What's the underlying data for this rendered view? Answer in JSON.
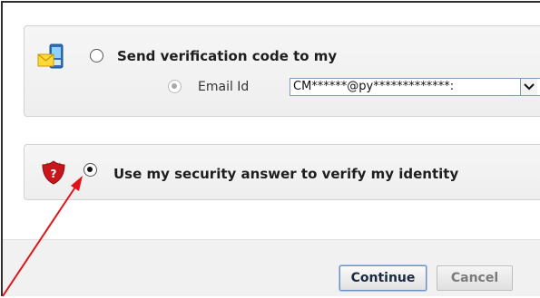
{
  "option_send_code": {
    "label": "Send verification code to my",
    "selected": false,
    "channel": {
      "label": "Email Id",
      "selected": true,
      "value": "CM******@py*************:"
    }
  },
  "option_security": {
    "label": "Use my security answer to verify my identity",
    "selected": true
  },
  "buttons": {
    "continue": "Continue",
    "cancel": "Cancel"
  },
  "annotation": {
    "color": "#e0131b",
    "kind": "arrow"
  },
  "icons": [
    "message-phone-icon",
    "security-shield-icon",
    "chevron-down-icon"
  ]
}
